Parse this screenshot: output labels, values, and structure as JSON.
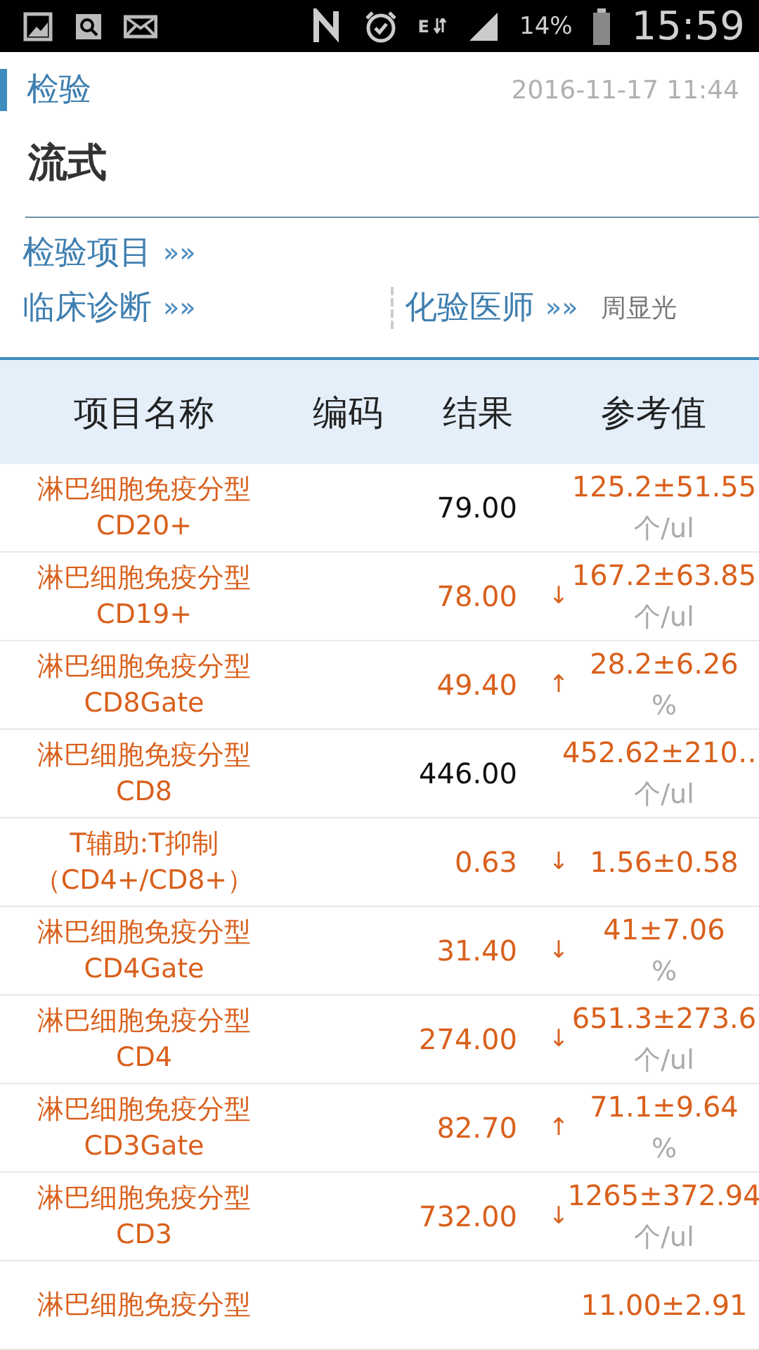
{
  "status_bar": {
    "network_type": "E",
    "battery": "14%",
    "time": "15:59"
  },
  "header": {
    "section": "检验",
    "timestamp": "2016-11-17 11:44",
    "title": "流式"
  },
  "links": [
    {
      "label": "检验项目",
      "arrows": "»»"
    }
  ],
  "info_row": [
    {
      "label": "临床诊断",
      "arrows": "»»"
    },
    {
      "label": "化验医师",
      "arrows": "»»",
      "value": "周显光"
    }
  ],
  "table": {
    "columns": [
      "项目名称",
      "编码",
      "结果",
      "参考值"
    ],
    "rows": [
      {
        "name": [
          "淋巴细胞免疫分型",
          "CD20+"
        ],
        "result": "79.00",
        "abnormal": false,
        "flag": "",
        "reference": "125.2±51.55",
        "unit": "个/ul"
      },
      {
        "name": [
          "淋巴细胞免疫分型",
          "CD19+"
        ],
        "result": "78.00",
        "abnormal": true,
        "flag": "↓",
        "reference": "167.2±63.85",
        "unit": "个/ul"
      },
      {
        "name": [
          "淋巴细胞免疫分型",
          "CD8Gate"
        ],
        "result": "49.40",
        "abnormal": true,
        "flag": "↑",
        "reference": "28.2±6.26",
        "unit": "%"
      },
      {
        "name": [
          "淋巴细胞免疫分型",
          "CD8"
        ],
        "result": "446.00",
        "abnormal": false,
        "flag": "",
        "reference": "452.62±210…",
        "unit": "个/ul"
      },
      {
        "name": [
          "T辅助:T抑制",
          "（CD4+/CD8+）"
        ],
        "result": "0.63",
        "abnormal": true,
        "flag": "↓",
        "reference": "1.56±0.58",
        "unit": ""
      },
      {
        "name": [
          "淋巴细胞免疫分型",
          "CD4Gate"
        ],
        "result": "31.40",
        "abnormal": true,
        "flag": "↓",
        "reference": "41±7.06",
        "unit": "%"
      },
      {
        "name": [
          "淋巴细胞免疫分型",
          "CD4"
        ],
        "result": "274.00",
        "abnormal": true,
        "flag": "↓",
        "reference": "651.3±273.6",
        "unit": "个/ul"
      },
      {
        "name": [
          "淋巴细胞免疫分型",
          "CD3Gate"
        ],
        "result": "82.70",
        "abnormal": true,
        "flag": "↑",
        "reference": "71.1±9.64",
        "unit": "%"
      },
      {
        "name": [
          "淋巴细胞免疫分型",
          "CD3"
        ],
        "result": "732.00",
        "abnormal": true,
        "flag": "↓",
        "reference": "1265±372.94",
        "unit": "个/ul"
      },
      {
        "name": [
          "淋巴细胞免疫分型"
        ],
        "result": "",
        "flag": "",
        "reference": "11.00±2.91",
        "unit": ""
      }
    ]
  }
}
